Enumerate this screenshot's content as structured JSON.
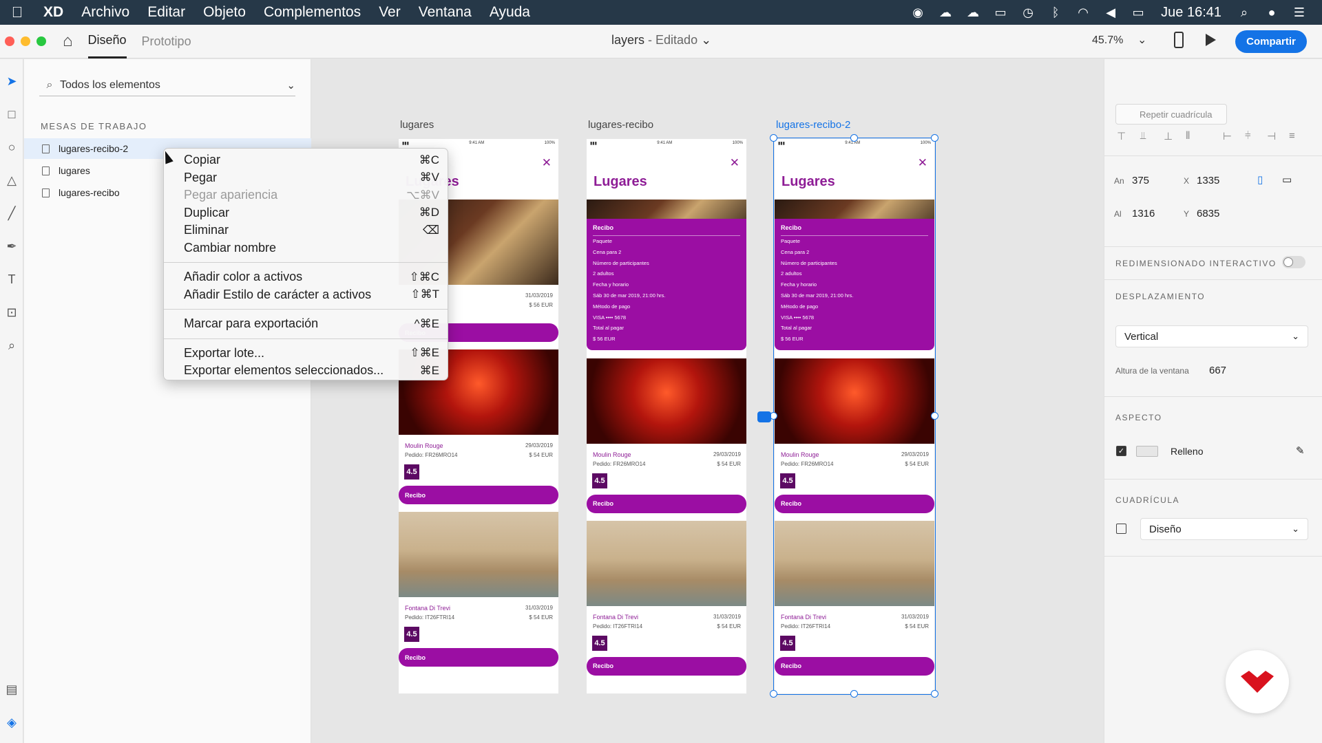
{
  "menubar": {
    "app": "XD",
    "items": [
      "Archivo",
      "Editar",
      "Objeto",
      "Complementos",
      "Ver",
      "Ventana",
      "Ayuda"
    ],
    "clock": "Jue 16:41"
  },
  "header": {
    "tabs": [
      "Diseño",
      "Prototipo"
    ],
    "doc_name": "layers",
    "doc_state": "- Editado",
    "zoom": "45.7%",
    "share": "Compartir"
  },
  "layers": {
    "search_placeholder": "Todos los elementos",
    "section": "MESAS DE TRABAJO",
    "items": [
      "lugares-recibo-2",
      "lugares",
      "lugares-recibo"
    ]
  },
  "context_menu": {
    "items": [
      {
        "label": "Copiar",
        "shortcut": "⌘C"
      },
      {
        "label": "Pegar",
        "shortcut": "⌘V"
      },
      {
        "label": "Pegar apariencia",
        "shortcut": "⌥⌘V"
      },
      {
        "label": "Duplicar",
        "shortcut": "⌘D"
      },
      {
        "label": "Eliminar",
        "shortcut": "⌫"
      },
      {
        "label": "Cambiar nombre",
        "shortcut": ""
      },
      {
        "label": "Añadir color a activos",
        "shortcut": "⇧⌘C"
      },
      {
        "label": "Añadir Estilo de carácter a activos",
        "shortcut": "⇧⌘T"
      },
      {
        "label": "Marcar para exportación",
        "shortcut": "^⌘E"
      },
      {
        "label": "Exportar lote...",
        "shortcut": "⇧⌘E"
      },
      {
        "label": "Exportar elementos seleccionados...",
        "shortcut": "⌘E"
      }
    ]
  },
  "artboards": [
    {
      "label": "lugares",
      "title": "Lugares"
    },
    {
      "label": "lugares-recibo",
      "title": "Lugares"
    },
    {
      "label": "lugares-recibo-2",
      "title": "Lugares"
    }
  ],
  "statusbar": {
    "time": "9:41 AM",
    "battery": "100%"
  },
  "receipt": {
    "title": "Recibo",
    "lines": [
      "Paquete",
      "Cena para 2",
      "Número de participantes",
      "2 adultos",
      "Fecha y horario",
      "Sáb 30 de mar 2019, 21:00 hrs.",
      "Método de pago",
      "VISA •••• 5678",
      "Total al pagar",
      "$ 56 EUR"
    ]
  },
  "places": [
    {
      "name": "Moulin Rouge",
      "date": "29/03/2019",
      "order": "Pedido: FR26MRO14",
      "price": "$ 54 EUR",
      "rating": "4.5",
      "button": "Recibo"
    },
    {
      "name": "Fontana Di Trevi",
      "date": "31/03/2019",
      "order": "Pedido: IT26FTRI14",
      "price": "$ 54 EUR",
      "rating": "4.5",
      "button": "Recibo"
    }
  ],
  "board1_card": {
    "date": "31/03/2019",
    "price": "$ 56 EUR"
  },
  "props": {
    "repeat_grid": "Repetir cuadrícula",
    "w_label": "An",
    "w": "375",
    "x_label": "X",
    "x": "1335",
    "h_label": "Al",
    "h": "1316",
    "y_label": "Y",
    "y": "6835",
    "responsive": "REDIMENSIONADO INTERACTIVO",
    "scrolling": "DESPLAZAMIENTO",
    "scroll_value": "Vertical",
    "viewport_label": "Altura de la ventana",
    "viewport": "667",
    "appearance": "ASPECTO",
    "fill": "Relleno",
    "grid": "CUADRÍCULA",
    "grid_value": "Diseño"
  },
  "colors": {
    "accent": "#1473e6",
    "purple": "#9b0ea3",
    "menubar": "#263848"
  }
}
